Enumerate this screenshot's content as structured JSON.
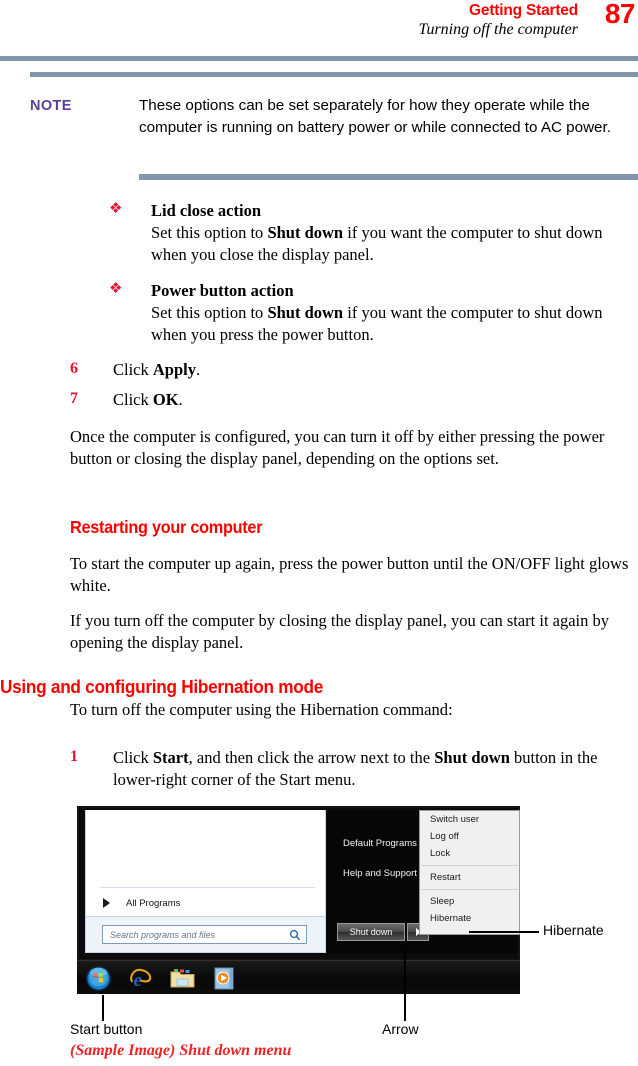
{
  "header": {
    "title": "Getting Started",
    "subtitle": "Turning off the computer",
    "page_number": "87",
    "title_color": "#ff0000",
    "rule_color": "#8296b0"
  },
  "note": {
    "label": "NOTE",
    "label_color": "#5a3f9e",
    "body": "These options can be set separately for how they operate while the computer is running on battery power or while connected to AC power."
  },
  "bullets": [
    {
      "marker": "❖",
      "heading": "Lid close action",
      "body_before": "Set this option to ",
      "body_bold": "Shut down",
      "body_after": " if you want the computer to shut down when you close the display panel."
    },
    {
      "marker": "❖",
      "heading": "Power button action",
      "body_before": "Set this option to ",
      "body_bold": "Shut down",
      "body_after": " if you want the computer to shut down when you press the power button."
    }
  ],
  "steps": {
    "six": {
      "num": "6",
      "before": "Click ",
      "bold": "Apply",
      "after": "."
    },
    "seven": {
      "num": "7",
      "before": "Click ",
      "bold": "OK",
      "after": "."
    },
    "one": {
      "num": "1",
      "before": "Click ",
      "bold": "Start",
      "mid": ", and then click the arrow next to the ",
      "bold2": "Shut down",
      "after": " button in the lower-right corner of the Start menu."
    }
  },
  "paragraphs": {
    "once_configured": "Once the computer is configured, you can turn it off by either pressing the power button or closing the display panel, depending on the options set.",
    "to_start": "To start the computer up again, press the power button until the ON/OFF light glows white.",
    "if_you_turn_off": "If you turn off the computer by closing the display panel, you can start it again by opening the display panel.",
    "to_turn_off": "To turn off the computer using the Hibernation command:"
  },
  "headings": {
    "restarting": "Restarting your computer",
    "hibernation": "Using and configuring Hibernation mode",
    "color": "#ff0000"
  },
  "screenshot": {
    "start_menu": {
      "all_programs": "All Programs",
      "search_placeholder": "Search programs and files",
      "right_items": [
        "Default Programs",
        "Help and Support"
      ],
      "shutdown_button": "Shut down"
    },
    "popup_menu": {
      "group1": [
        "Switch user",
        "Log off",
        "Lock"
      ],
      "group2": [
        "Restart"
      ],
      "group3": [
        "Sleep",
        "Hibernate"
      ]
    },
    "taskbar_icons": [
      "start-orb-icon",
      "internet-explorer-icon",
      "windows-explorer-icon",
      "media-player-icon"
    ]
  },
  "callouts": {
    "hibernate": "Hibernate",
    "start_button": "Start button",
    "arrow": "Arrow"
  },
  "caption": "(Sample Image) Shut down menu"
}
